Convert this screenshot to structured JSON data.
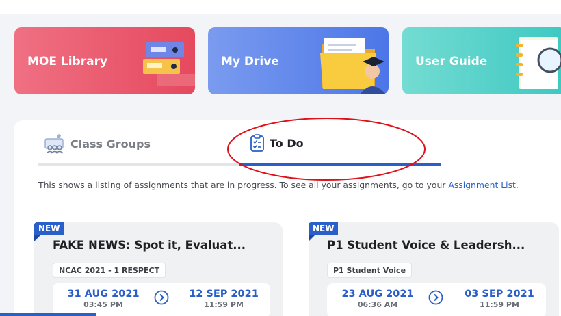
{
  "tiles": [
    {
      "label": "MOE Library",
      "icon": "binders-icon"
    },
    {
      "label": "My Drive",
      "icon": "folder-graduate-icon"
    },
    {
      "label": "User Guide",
      "icon": "notebook-magnifier-icon"
    }
  ],
  "tabs": {
    "class_groups": "Class Groups",
    "todo": "To Do"
  },
  "info": {
    "text": "This shows a listing of assignments that are in progress. To see all your assignments, go to your ",
    "link": "Assignment List",
    "end": "."
  },
  "cards": [
    {
      "badge": "NEW",
      "title": "FAKE NEWS: Spot it, Evaluat...",
      "tag": "NCAC 2021 - 1 RESPECT",
      "start_date": "31 AUG 2021",
      "start_time": "03:45 PM",
      "end_date": "12 SEP 2021",
      "end_time": "11:59 PM"
    },
    {
      "badge": "NEW",
      "title": "P1 Student Voice & Leadersh...",
      "tag": "P1 Student Voice",
      "start_date": "23 AUG 2021",
      "start_time": "06:36 AM",
      "end_date": "03 SEP 2021",
      "end_time": "11:59 PM"
    }
  ],
  "colors": {
    "accent": "#2a5ec9",
    "annotation": "#e0101a"
  }
}
